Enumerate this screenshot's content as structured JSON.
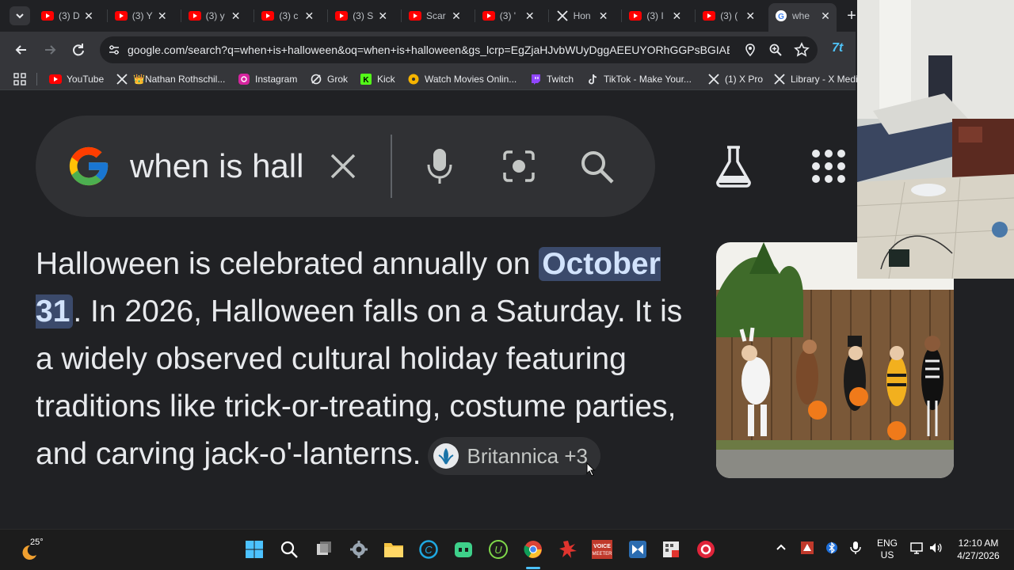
{
  "browser": {
    "tabs": [
      {
        "title": "(3) D",
        "icon": "youtube-icon"
      },
      {
        "title": "(3) Y",
        "icon": "youtube-icon"
      },
      {
        "title": "(3) y",
        "icon": "youtube-icon"
      },
      {
        "title": "(3) c",
        "icon": "youtube-icon"
      },
      {
        "title": "(3) S",
        "icon": "youtube-icon"
      },
      {
        "title": "Scar",
        "icon": "youtube-icon"
      },
      {
        "title": "(3) '",
        "icon": "youtube-icon"
      },
      {
        "title": "Hon",
        "icon": "x-icon"
      },
      {
        "title": "(3) I",
        "icon": "youtube-icon"
      },
      {
        "title": "(3) (",
        "icon": "youtube-icon"
      },
      {
        "title": "whe",
        "icon": "google-icon",
        "active": true
      }
    ],
    "url": "google.com/search?q=when+is+halloween&oq=when+is+halloween&gs_lcrp=EgZjaHJvbWUyDggAEEUYORhGGPsBGIAE...",
    "bookmarks": [
      {
        "label": "YouTube",
        "icon": "youtube-icon"
      },
      {
        "label": "👑Nathan Rothschil...",
        "icon": "x-icon"
      },
      {
        "label": "Instagram",
        "icon": "instagram-icon"
      },
      {
        "label": "Grok",
        "icon": "grok-icon"
      },
      {
        "label": "Kick",
        "icon": "kick-icon"
      },
      {
        "label": "Watch Movies Onlin...",
        "icon": "movies-icon"
      },
      {
        "label": "Twitch",
        "icon": "twitch-icon"
      },
      {
        "label": "TikTok - Make Your...",
        "icon": "tiktok-icon"
      },
      {
        "label": "(1) X Pro",
        "icon": "x-icon"
      },
      {
        "label": "Library - X Medi",
        "icon": "x-icon"
      }
    ]
  },
  "search": {
    "query": "when is hall"
  },
  "answer": {
    "pre": "Halloween is celebrated annually on ",
    "highlight": "October 31",
    "post": ". In 2026, Halloween falls on a Saturday. It is a widely observed cultural holiday featuring traditions like trick-or-treating, costume parties, and carving jack-o'-lanterns.",
    "source": "Britannica +3"
  },
  "taskbar": {
    "weather": "25°",
    "lang": "ENG",
    "region": "US",
    "time": "12:10 AM",
    "date": "4/27/2026"
  },
  "colors": {
    "background": "#202124",
    "toolbar": "#35363a",
    "highlight": "#3b4a6b",
    "youtube": "#ff0000"
  }
}
